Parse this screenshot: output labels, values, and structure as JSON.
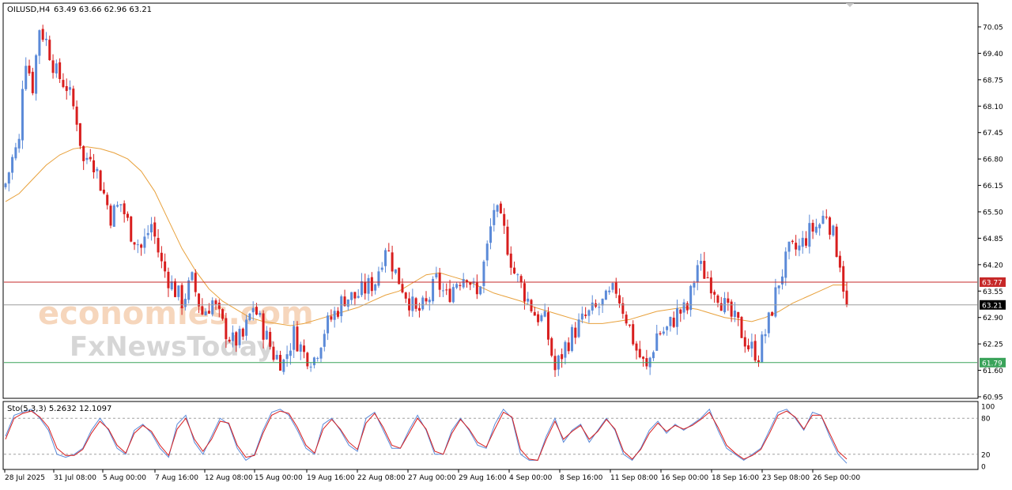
{
  "header": {
    "symbol_timeframe": "OILUSD,H4",
    "ohlc": "63.49 63.66 62.96 63.21"
  },
  "stoch_header": "Sto(5,3,3) 5.2632 12.1097",
  "watermark": {
    "line1": "economies.com",
    "line2": "FxNewsToday"
  },
  "colors": {
    "bull": "#5b8ad8",
    "bear": "#d81e1e",
    "ma": "#e8a13c",
    "resistance": "#c62828",
    "support": "#3aa35a",
    "stoch_main": "#5b8ad8",
    "stoch_signal": "#d81e1e"
  },
  "price_axis": [
    "70.05",
    "69.40",
    "68.75",
    "68.10",
    "67.45",
    "66.80",
    "66.15",
    "65.50",
    "64.85",
    "64.20",
    "63.55",
    "62.90",
    "62.25",
    "61.60",
    "60.95"
  ],
  "stoch_axis": [
    "100",
    "80",
    "20",
    "0"
  ],
  "levels": {
    "resistance": "63.77",
    "current": "63.21",
    "support": "61.79"
  },
  "time_axis": [
    "28 Jul 2025",
    "31 Jul 08:00",
    "5 Aug 00:00",
    "7 Aug 16:00",
    "12 Aug 08:00",
    "15 Aug 00:00",
    "19 Aug 16:00",
    "22 Aug 08:00",
    "27 Aug 00:00",
    "29 Aug 16:00",
    "4 Sep 00:00",
    "8 Sep 16:00",
    "11 Sep 08:00",
    "16 Sep 00:00",
    "18 Sep 16:00",
    "23 Sep 08:00",
    "26 Sep 00:00"
  ],
  "chart_data": [
    {
      "type": "candlestick",
      "title": "OILUSD,H4",
      "ylim": [
        60.95,
        70.05
      ],
      "close_path": [
        [
          0,
          66.2
        ],
        [
          2,
          66.8
        ],
        [
          4,
          67.2
        ],
        [
          5,
          68.7
        ],
        [
          6,
          69.3
        ],
        [
          8,
          68.6
        ],
        [
          10,
          70.05
        ],
        [
          12,
          69.7
        ],
        [
          15,
          68.9
        ],
        [
          18,
          68.6
        ],
        [
          21,
          67.8
        ],
        [
          23,
          66.7
        ],
        [
          25,
          67.0
        ],
        [
          28,
          66.2
        ],
        [
          31,
          65.4
        ],
        [
          34,
          65.7
        ],
        [
          37,
          65.0
        ],
        [
          40,
          64.6
        ],
        [
          43,
          65.2
        ],
        [
          46,
          64.2
        ],
        [
          49,
          63.7
        ],
        [
          52,
          63.3
        ],
        [
          55,
          63.8
        ],
        [
          58,
          63.0
        ],
        [
          61,
          63.3
        ],
        [
          64,
          62.7
        ],
        [
          67,
          62.3
        ],
        [
          70,
          62.4
        ],
        [
          73,
          63.2
        ],
        [
          76,
          62.6
        ],
        [
          79,
          62.0
        ],
        [
          82,
          61.8
        ],
        [
          85,
          62.5
        ],
        [
          88,
          62.0
        ],
        [
          91,
          61.9
        ],
        [
          94,
          62.6
        ],
        [
          97,
          63.0
        ],
        [
          100,
          63.4
        ],
        [
          103,
          63.4
        ],
        [
          106,
          63.6
        ],
        [
          109,
          63.8
        ],
        [
          112,
          64.7
        ],
        [
          115,
          64.0
        ],
        [
          118,
          63.5
        ],
        [
          121,
          63.0
        ],
        [
          124,
          63.2
        ],
        [
          127,
          63.8
        ],
        [
          130,
          63.4
        ],
        [
          133,
          63.8
        ],
        [
          136,
          64.0
        ],
        [
          139,
          63.4
        ],
        [
          142,
          64.6
        ],
        [
          144,
          65.6
        ],
        [
          147,
          65.0
        ],
        [
          150,
          64.0
        ],
        [
          153,
          63.5
        ],
        [
          156,
          63.0
        ],
        [
          159,
          62.8
        ],
        [
          162,
          61.6
        ],
        [
          165,
          62.2
        ],
        [
          168,
          62.6
        ],
        [
          171,
          62.9
        ],
        [
          174,
          63.1
        ],
        [
          177,
          63.3
        ],
        [
          180,
          63.6
        ],
        [
          183,
          62.9
        ],
        [
          186,
          62.1
        ],
        [
          189,
          61.6
        ],
        [
          192,
          62.5
        ],
        [
          195,
          62.6
        ],
        [
          198,
          63.0
        ],
        [
          201,
          63.1
        ],
        [
          204,
          64.2
        ],
        [
          207,
          63.9
        ],
        [
          210,
          63.5
        ],
        [
          213,
          63.0
        ],
        [
          216,
          62.7
        ],
        [
          219,
          62.2
        ],
        [
          222,
          62.0
        ],
        [
          225,
          62.8
        ],
        [
          228,
          63.8
        ],
        [
          231,
          64.5
        ],
        [
          234,
          64.6
        ],
        [
          237,
          65.0
        ],
        [
          240,
          65.2
        ],
        [
          242,
          65.5
        ],
        [
          244,
          64.9
        ],
        [
          246,
          64.3
        ],
        [
          247,
          63.7
        ],
        [
          248,
          63.21
        ]
      ],
      "moving_average": [
        [
          0,
          65.75
        ],
        [
          4,
          65.95
        ],
        [
          8,
          66.3
        ],
        [
          12,
          66.65
        ],
        [
          16,
          66.9
        ],
        [
          20,
          67.05
        ],
        [
          24,
          67.1
        ],
        [
          28,
          67.05
        ],
        [
          32,
          66.95
        ],
        [
          36,
          66.8
        ],
        [
          40,
          66.5
        ],
        [
          44,
          66.0
        ],
        [
          48,
          65.3
        ],
        [
          52,
          64.6
        ],
        [
          56,
          64.05
        ],
        [
          60,
          63.6
        ],
        [
          64,
          63.3
        ],
        [
          68,
          63.1
        ],
        [
          72,
          62.9
        ],
        [
          76,
          62.8
        ],
        [
          80,
          62.75
        ],
        [
          84,
          62.7
        ],
        [
          88,
          62.75
        ],
        [
          92,
          62.85
        ],
        [
          96,
          62.95
        ],
        [
          100,
          63.05
        ],
        [
          104,
          63.15
        ],
        [
          108,
          63.3
        ],
        [
          112,
          63.45
        ],
        [
          116,
          63.55
        ],
        [
          120,
          63.75
        ],
        [
          124,
          63.95
        ],
        [
          128,
          64.0
        ],
        [
          132,
          63.9
        ],
        [
          136,
          63.8
        ],
        [
          140,
          63.65
        ],
        [
          144,
          63.5
        ],
        [
          148,
          63.4
        ],
        [
          152,
          63.3
        ],
        [
          156,
          63.15
        ],
        [
          160,
          63.05
        ],
        [
          164,
          62.95
        ],
        [
          168,
          62.85
        ],
        [
          172,
          62.75
        ],
        [
          176,
          62.75
        ],
        [
          180,
          62.8
        ],
        [
          184,
          62.85
        ],
        [
          188,
          62.95
        ],
        [
          192,
          63.05
        ],
        [
          196,
          63.1
        ],
        [
          200,
          63.15
        ],
        [
          204,
          63.1
        ],
        [
          208,
          63.0
        ],
        [
          212,
          62.9
        ],
        [
          216,
          62.85
        ],
        [
          220,
          62.8
        ],
        [
          224,
          62.9
        ],
        [
          228,
          63.05
        ],
        [
          232,
          63.25
        ],
        [
          236,
          63.4
        ],
        [
          240,
          63.55
        ],
        [
          244,
          63.7
        ],
        [
          248,
          63.7
        ]
      ],
      "horizontal_levels": [
        63.77,
        63.21,
        61.79
      ]
    },
    {
      "type": "line",
      "title": "Sto(5,3,3)",
      "ylim": [
        0,
        100
      ],
      "reference_lines": [
        80,
        20
      ],
      "series": [
        {
          "name": "main",
          "values": [
            50,
            85,
            90,
            95,
            80,
            60,
            20,
            15,
            20,
            30,
            60,
            80,
            60,
            30,
            20,
            60,
            70,
            55,
            30,
            15,
            70,
            85,
            40,
            20,
            50,
            80,
            70,
            30,
            10,
            20,
            60,
            90,
            95,
            85,
            60,
            30,
            20,
            70,
            80,
            60,
            35,
            25,
            80,
            90,
            60,
            30,
            30,
            60,
            85,
            60,
            20,
            20,
            60,
            80,
            60,
            35,
            30,
            70,
            95,
            80,
            20,
            10,
            10,
            50,
            80,
            40,
            60,
            70,
            40,
            60,
            80,
            60,
            20,
            10,
            30,
            60,
            75,
            55,
            70,
            60,
            70,
            80,
            95,
            60,
            30,
            20,
            10,
            20,
            30,
            60,
            90,
            95,
            80,
            60,
            90,
            85,
            50,
            20,
            5
          ]
        },
        {
          "name": "signal",
          "values": [
            45,
            80,
            88,
            92,
            82,
            65,
            30,
            18,
            18,
            28,
            55,
            75,
            62,
            35,
            22,
            55,
            68,
            58,
            35,
            18,
            62,
            80,
            45,
            25,
            45,
            75,
            72,
            35,
            15,
            18,
            55,
            85,
            92,
            88,
            65,
            35,
            22,
            62,
            78,
            62,
            40,
            28,
            72,
            88,
            65,
            35,
            30,
            55,
            80,
            62,
            25,
            20,
            55,
            78,
            62,
            40,
            32,
            62,
            90,
            82,
            28,
            12,
            10,
            45,
            75,
            45,
            58,
            68,
            45,
            58,
            78,
            62,
            25,
            12,
            28,
            55,
            72,
            58,
            68,
            62,
            68,
            78,
            90,
            65,
            35,
            22,
            12,
            18,
            28,
            55,
            85,
            92,
            82,
            62,
            85,
            85,
            55,
            25,
            12
          ]
        }
      ]
    }
  ]
}
